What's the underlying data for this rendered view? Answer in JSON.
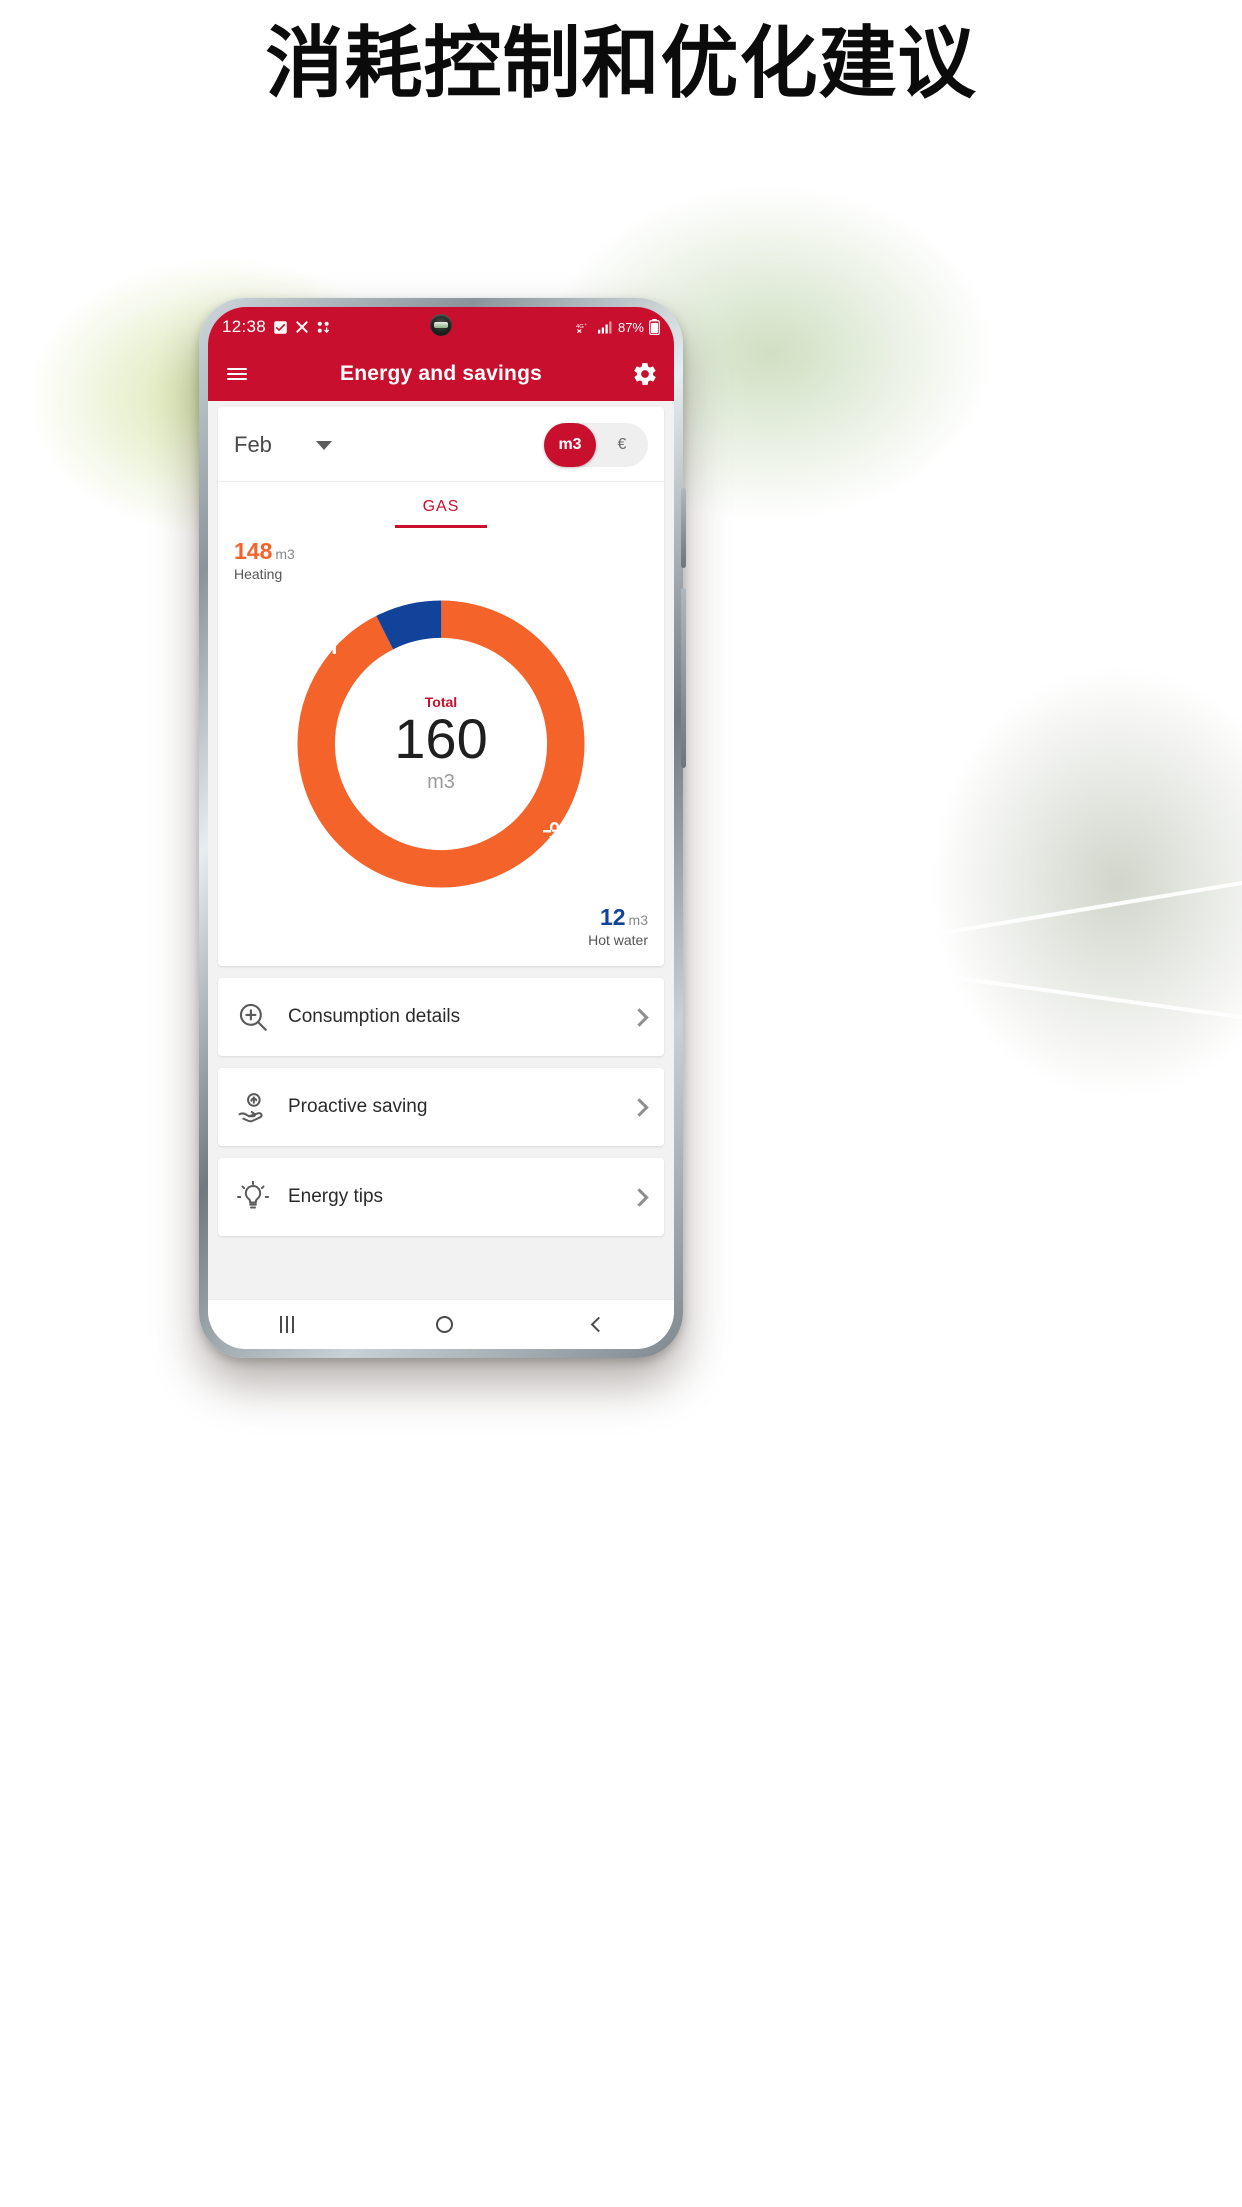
{
  "theme": {
    "brand_red": "#c8102e",
    "orange": "#f4642a",
    "blue": "#12439a"
  },
  "headline": "消耗控制和优化建议",
  "phone": {
    "statusbar": {
      "time": "12:38",
      "icons": [
        "checkbox-checked-icon",
        "close-x-icon",
        "apps-grid-icon"
      ],
      "network": "4G+",
      "signal": "signal-bars-icon",
      "battery_percent": "87%",
      "battery_icon": "battery-icon"
    },
    "appbar": {
      "menu_icon": "hamburger-menu-icon",
      "title": "Energy and savings",
      "settings_icon": "gear-icon"
    },
    "period": {
      "month": "Feb",
      "dropdown_icon": "chevron-down-icon",
      "units": [
        {
          "label": "m3",
          "active": true
        },
        {
          "label": "€",
          "active": false
        }
      ]
    },
    "tabs": [
      {
        "label": "GAS",
        "active": true
      }
    ],
    "list": [
      {
        "label": "Consumption details",
        "icon": "magnifier-plus-icon",
        "chevron": "chevron-right-icon"
      },
      {
        "label": "Proactive saving",
        "icon": "hand-savings-icon",
        "chevron": "chevron-right-icon"
      },
      {
        "label": "Energy tips",
        "icon": "lightbulb-icon",
        "chevron": "chevron-right-icon"
      }
    ],
    "navbar": {
      "recents": "recents-icon",
      "home": "home-icon",
      "back": "back-icon"
    }
  },
  "chart_data": {
    "type": "pie",
    "title": "Total",
    "center_value": "160",
    "center_unit": "m3",
    "unit": "m3",
    "total": 160,
    "categories": [
      "Heating",
      "Hot water"
    ],
    "values": [
      148,
      12
    ],
    "labels": [
      {
        "name": "Heating",
        "value": "148",
        "unit": "m3",
        "color": "#f4642a",
        "icon": "radiator-icon"
      },
      {
        "name": "Hot water",
        "value": "12",
        "unit": "m3",
        "color": "#12439a",
        "icon": "faucet-icon"
      }
    ],
    "legend": "inline-labels",
    "grid": false
  }
}
